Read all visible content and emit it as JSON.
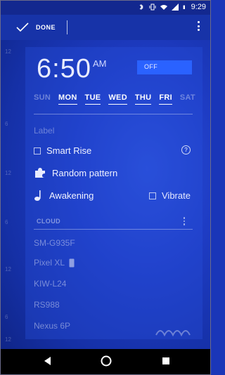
{
  "status": {
    "time": "9:29",
    "icons": [
      "bluetooth-icon",
      "vibrate-icon",
      "wifi-icon",
      "signal-icon",
      "battery-icon"
    ]
  },
  "toolbar": {
    "done_label": "DONE"
  },
  "timeline": {
    "labels": [
      "12",
      "6",
      "12",
      "6",
      "12",
      "6",
      "12"
    ]
  },
  "alarm": {
    "hour": "6:50",
    "ampm": "AM",
    "toggle_label": "OFF",
    "days": [
      {
        "label": "SUN",
        "active": false
      },
      {
        "label": "MON",
        "active": true
      },
      {
        "label": "TUE",
        "active": true
      },
      {
        "label": "WED",
        "active": true
      },
      {
        "label": "THU",
        "active": true
      },
      {
        "label": "FRI",
        "active": true
      },
      {
        "label": "SAT",
        "active": false
      }
    ],
    "label_placeholder": "Label",
    "smart_rise": "Smart Rise",
    "help": "?",
    "pattern": "Random pattern",
    "sound": "Awakening",
    "vibrate": "Vibrate"
  },
  "cloud": {
    "title": "CLOUD",
    "devices": [
      "SM-G935F",
      "Pixel XL",
      "KIW-L24",
      "RS988",
      "Nexus 6P"
    ]
  },
  "colors": {
    "toggle": "#2a62ff",
    "background": "#1e3cc4",
    "statusbar": "#13288f"
  }
}
